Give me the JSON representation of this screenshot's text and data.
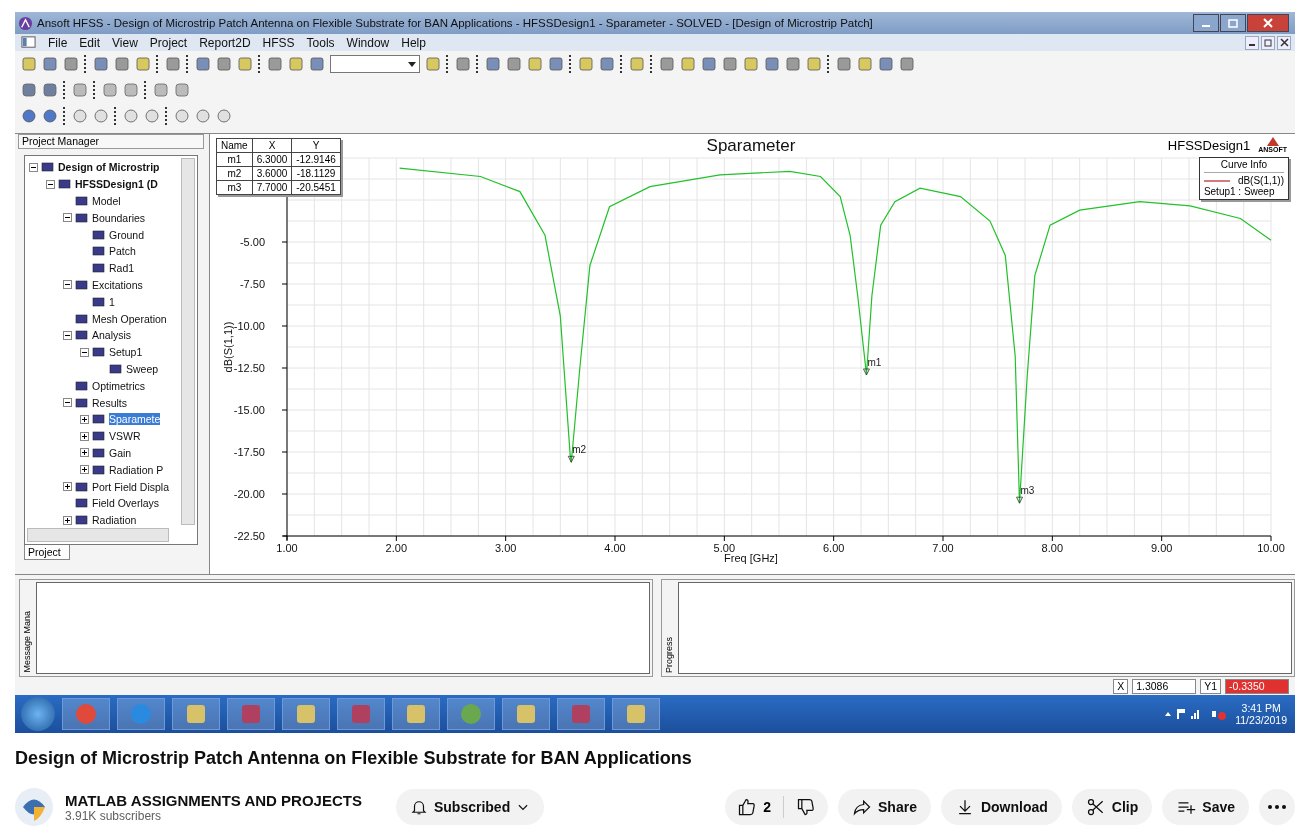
{
  "window": {
    "title": "Ansoft HFSS  - Design of Microstrip Patch Antenna on Flexible Substrate for BAN Applications - HFSSDesign1 - Sparameter - SOLVED - [Design of Microstrip Patch]"
  },
  "menu": [
    "File",
    "Edit",
    "View",
    "Project",
    "Report2D",
    "HFSS",
    "Tools",
    "Window",
    "Help"
  ],
  "project_manager": {
    "title": "Project Manager",
    "tab": "Project",
    "tree": [
      {
        "label": "Design of Microstrip",
        "bold": true,
        "expanded": true,
        "selected": false,
        "children": [
          {
            "label": "HFSSDesign1 (D",
            "bold": true,
            "expanded": true,
            "selected": false,
            "children": [
              {
                "label": "Model",
                "bold": false,
                "selected": false
              },
              {
                "label": "Boundaries",
                "bold": false,
                "expanded": true,
                "selected": false,
                "children": [
                  {
                    "label": "Ground",
                    "bold": false,
                    "selected": false
                  },
                  {
                    "label": "Patch",
                    "bold": false,
                    "selected": false
                  },
                  {
                    "label": "Rad1",
                    "bold": false,
                    "selected": false
                  }
                ]
              },
              {
                "label": "Excitations",
                "bold": false,
                "expanded": true,
                "selected": false,
                "children": [
                  {
                    "label": "1",
                    "bold": false,
                    "selected": false
                  }
                ]
              },
              {
                "label": "Mesh Operation",
                "bold": false,
                "selected": false
              },
              {
                "label": "Analysis",
                "bold": false,
                "expanded": true,
                "selected": false,
                "children": [
                  {
                    "label": "Setup1",
                    "bold": false,
                    "expanded": true,
                    "selected": false,
                    "children": [
                      {
                        "label": "Sweep",
                        "bold": false,
                        "selected": false
                      }
                    ]
                  }
                ]
              },
              {
                "label": "Optimetrics",
                "bold": false,
                "selected": false
              },
              {
                "label": "Results",
                "bold": false,
                "expanded": true,
                "selected": false,
                "children": [
                  {
                    "label": "Sparamete",
                    "bold": false,
                    "expanded": false,
                    "selected": true
                  },
                  {
                    "label": "VSWR",
                    "bold": false,
                    "expanded": false,
                    "selected": false
                  },
                  {
                    "label": "Gain",
                    "bold": false,
                    "expanded": false,
                    "selected": false
                  },
                  {
                    "label": "Radiation P",
                    "bold": false,
                    "expanded": false,
                    "selected": false
                  }
                ]
              },
              {
                "label": "Port Field Displa",
                "bold": false,
                "expanded": false,
                "selected": false
              },
              {
                "label": "Field Overlays",
                "bold": false,
                "selected": false
              },
              {
                "label": "Radiation",
                "bold": false,
                "expanded": false,
                "selected": false
              }
            ]
          }
        ]
      }
    ]
  },
  "plot": {
    "design": "HFSSDesign1",
    "logo": "ANSOFT",
    "markers": {
      "columns": [
        "Name",
        "X",
        "Y"
      ],
      "rows": [
        [
          "m1",
          "6.3000",
          "-12.9146"
        ],
        [
          "m2",
          "3.6000",
          "-18.1129"
        ],
        [
          "m3",
          "7.7000",
          "-20.5451"
        ]
      ]
    },
    "marker_labels": [
      "m1",
      "m2",
      "m3"
    ],
    "legend": {
      "title": "Curve Info",
      "setup": "Setup1 : Sweep"
    },
    "chart_data": {
      "type": "line",
      "title": "Sparameter",
      "xlabel": "Freq [GHz]",
      "ylabel": "dB(S(1,1))",
      "x": [
        2.03,
        2.77,
        3.13,
        3.36,
        3.5,
        3.59,
        3.6,
        3.68,
        3.77,
        3.95,
        4.32,
        4.96,
        5.6,
        5.88,
        6.06,
        6.15,
        6.22,
        6.3,
        6.35,
        6.43,
        6.56,
        6.79,
        7.16,
        7.43,
        7.57,
        7.66,
        7.7,
        7.77,
        7.84,
        7.98,
        8.25,
        8.8,
        9.26,
        9.72,
        10
      ],
      "series": [
        {
          "name": "dB(S(1,1))",
          "color": "#22c02a",
          "values": [
            -0.6,
            -1.1,
            -2.0,
            -4.6,
            -9.4,
            -17.7,
            -18.11,
            -12.4,
            -6.4,
            -2.9,
            -1.7,
            -1.0,
            -0.8,
            -1.1,
            -2.3,
            -4.6,
            -8.2,
            -12.91,
            -8.2,
            -4.0,
            -2.6,
            -1.8,
            -2.3,
            -3.75,
            -5.8,
            -11.8,
            -20.55,
            -13.0,
            -7.0,
            -4.0,
            -3.1,
            -2.6,
            -2.85,
            -3.6,
            -4.9
          ]
        }
      ],
      "xlim": [
        1,
        10
      ],
      "ylim": [
        -22.5,
        0
      ],
      "grid": true,
      "xticks": [
        {
          "value": 1,
          "label": "1.00"
        },
        {
          "value": 2,
          "label": "2.00"
        },
        {
          "value": 3,
          "label": "3.00"
        },
        {
          "value": 4,
          "label": "4.00"
        },
        {
          "value": 5,
          "label": "5.00"
        },
        {
          "value": 6,
          "label": "6.00"
        },
        {
          "value": 7,
          "label": "7.00"
        },
        {
          "value": 8,
          "label": "8.00"
        },
        {
          "value": 9,
          "label": "9.00"
        },
        {
          "value": 10,
          "label": "10.00"
        }
      ],
      "yticks": [
        {
          "value": -22.5,
          "label": "-22.50"
        },
        {
          "value": -20,
          "label": "-20.00"
        },
        {
          "value": -17.5,
          "label": "-17.50"
        },
        {
          "value": -15,
          "label": "-15.00"
        },
        {
          "value": -12.5,
          "label": "-12.50"
        },
        {
          "value": -10,
          "label": "-10.00"
        },
        {
          "value": -7.5,
          "label": "-7.50"
        },
        {
          "value": -5,
          "label": "-5.00"
        }
      ]
    }
  },
  "panels": {
    "messages": "Message Mana",
    "progress": "Progress"
  },
  "status_bar": {
    "x_label": "X",
    "x_value": "1.3086",
    "y_label": "Y1",
    "y_value": "-0.3350"
  },
  "taskbar": {
    "time": "3:41 PM",
    "date": "11/23/2019"
  },
  "video": {
    "title": "Design of Microstrip Patch Antenna on Flexible Substrate for BAN Applications",
    "channel": "MATLAB ASSIGNMENTS AND PROJECTS",
    "subscribers": "3.91K subscribers",
    "subscribe": "Subscribed",
    "likes": "2",
    "share": "Share",
    "download": "Download",
    "clip": "Clip",
    "save": "Save"
  }
}
